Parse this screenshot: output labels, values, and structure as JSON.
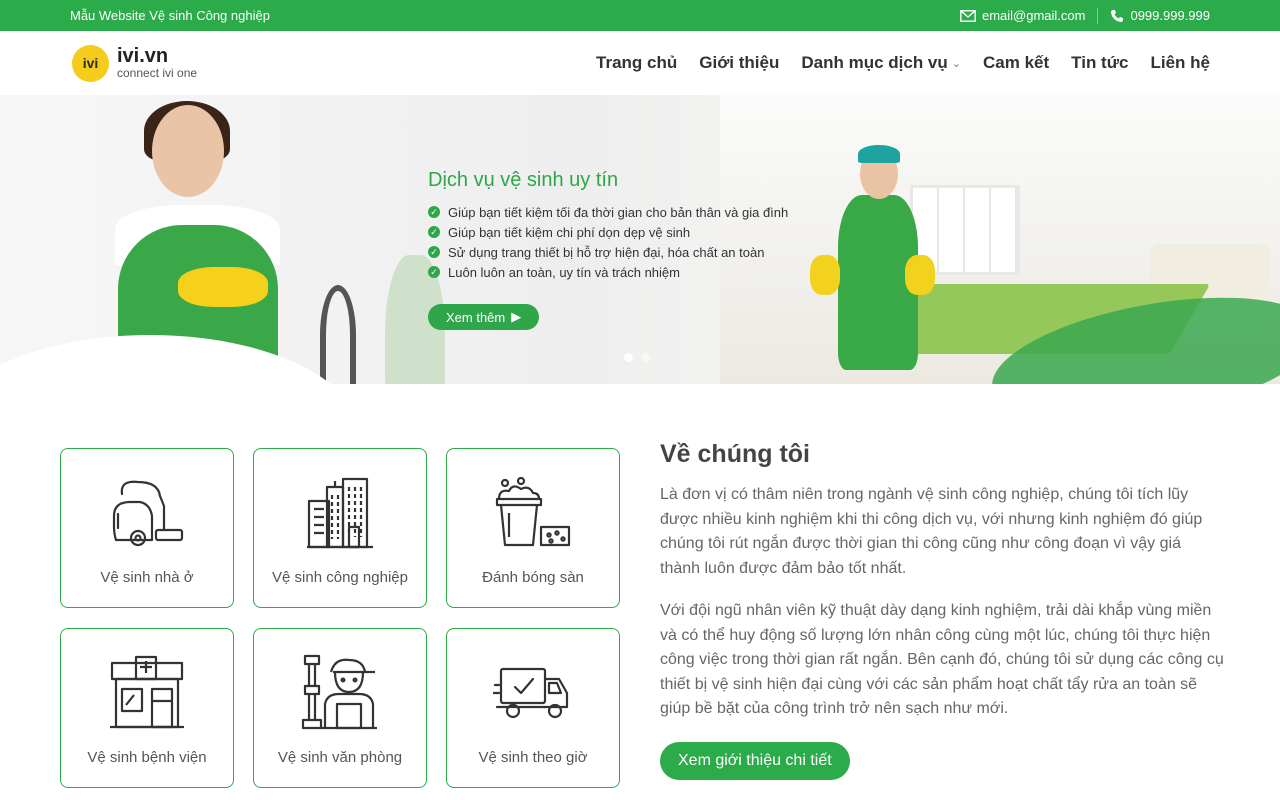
{
  "topbar": {
    "site_name": "Mẫu Website Vệ sinh Công nghiệp",
    "email": "email@gmail.com",
    "phone": "0999.999.999"
  },
  "header": {
    "logo_mark": "ivi",
    "logo_brand": "ivi.vn",
    "logo_tagline": "connect ivi one",
    "nav": [
      {
        "label": "Trang chủ"
      },
      {
        "label": "Giới thiệu"
      },
      {
        "label": "Danh mục dịch vụ"
      },
      {
        "label": "Cam kết"
      },
      {
        "label": "Tin tức"
      },
      {
        "label": "Liên hệ"
      }
    ]
  },
  "hero": {
    "title": "Dịch vụ vệ sinh uy tín",
    "bullets": [
      "Giúp bạn tiết kiệm tối đa thời gian cho bản thân và gia đình",
      "Giúp bạn tiết kiệm chi phí dọn dẹp vệ sinh",
      "Sử dụng trang thiết bị hỗ trợ hiện đại, hóa chất an toàn",
      "Luôn luôn an toàn, uy tín và trách nhiệm"
    ],
    "button": "Xem thêm"
  },
  "services": [
    {
      "label": "Vệ sinh nhà ở",
      "icon": "vacuum-cleaner-icon"
    },
    {
      "label": "Vệ sinh công nghiệp",
      "icon": "buildings-icon"
    },
    {
      "label": "Đánh bóng sàn",
      "icon": "bucket-sponge-icon"
    },
    {
      "label": "Vệ sinh bệnh viện",
      "icon": "hospital-icon"
    },
    {
      "label": "Vệ sinh văn phòng",
      "icon": "worker-icon"
    },
    {
      "label": "Vệ sinh theo giờ",
      "icon": "delivery-truck-icon"
    }
  ],
  "about": {
    "title": "Về chúng tôi",
    "paragraph1": "Là đơn vị có thâm niên trong ngành vệ sinh công nghiệp, chúng tôi tích lũy được nhiều kinh nghiệm khi thi công dịch vụ, với nhưng kinh nghiệm đó giúp chúng tôi rút ngắn được thời gian thi công cũng như công đoạn vì vậy giá thành luôn được đảm bảo tốt nhất.",
    "paragraph2": "Với đội ngũ nhân viên kỹ thuật dày dạng kinh nghiệm, trải dài khắp vùng miền và có thể huy động số lượng lớn nhân công cùng một lúc, chúng tôi thực hiện công việc trong thời gian rất ngắn. Bên cạnh đó, chúng tôi sử dụng các công cụ thiết bị vệ sinh hiện đại cùng với các sản phẩm hoạt chất tẩy rửa an toàn sẽ giúp bề bặt của công trình trở nên sạch như mới.",
    "button": "Xem giới thiệu chi tiết"
  },
  "colors": {
    "brand_green": "#2cab4b",
    "logo_yellow": "#f4cc1c"
  }
}
